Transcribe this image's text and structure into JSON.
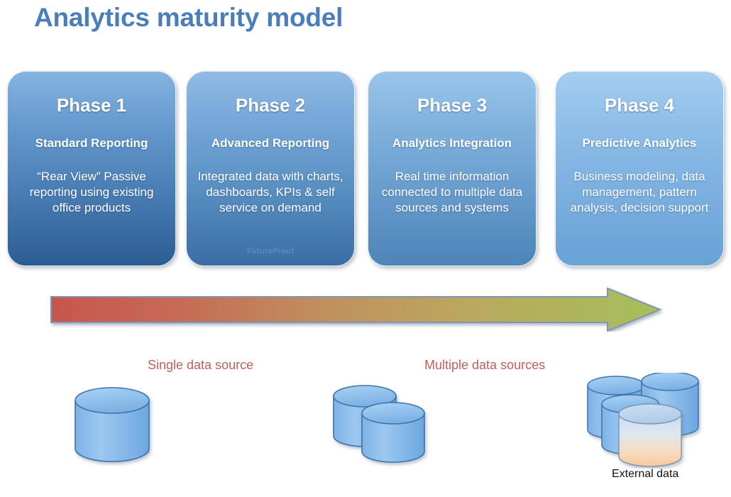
{
  "title": "Analytics maturity model",
  "colors": {
    "title": "#4a7ebb",
    "label_red": "#c0605c",
    "arrow_start": "#c85a52",
    "arrow_mid": "#c39a5e",
    "arrow_end": "#a5c05a",
    "arrow_outline": "#8094b4",
    "cylinder_fill_light": "#a9cef1",
    "cylinder_fill_dark": "#6ba6e0",
    "cylinder_outline": "#3f73a8",
    "external_fill_bottom": "#f6cba2",
    "external_label": "#101010"
  },
  "phases": [
    {
      "id": "phase-1",
      "title": "Phase 1",
      "subtitle": "Standard Reporting",
      "description": "“Rear View” Passive reporting using existing office products",
      "watermark": ""
    },
    {
      "id": "phase-2",
      "title": "Phase 2",
      "subtitle": "Advanced Reporting",
      "description": "Integrated data with charts, dashboards, KPIs & self service on demand",
      "watermark": "FutureProof"
    },
    {
      "id": "phase-3",
      "title": "Phase 3",
      "subtitle": "Analytics Integration",
      "description": "Real time information connected to multiple data sources and systems",
      "watermark": ""
    },
    {
      "id": "phase-4",
      "title": "Phase 4",
      "subtitle": "Predictive Analytics",
      "description": "Business modeling, data management, pattern analysis, decision support",
      "watermark": ""
    }
  ],
  "arrow": {
    "name": "progression-arrow",
    "direction": "left-to-right"
  },
  "data_sources": {
    "single_label": "Single data source",
    "multiple_label": "Multiple data sources",
    "external_label": "External data",
    "single_count": 1,
    "multiple_count": 2,
    "cluster_count": 4
  }
}
